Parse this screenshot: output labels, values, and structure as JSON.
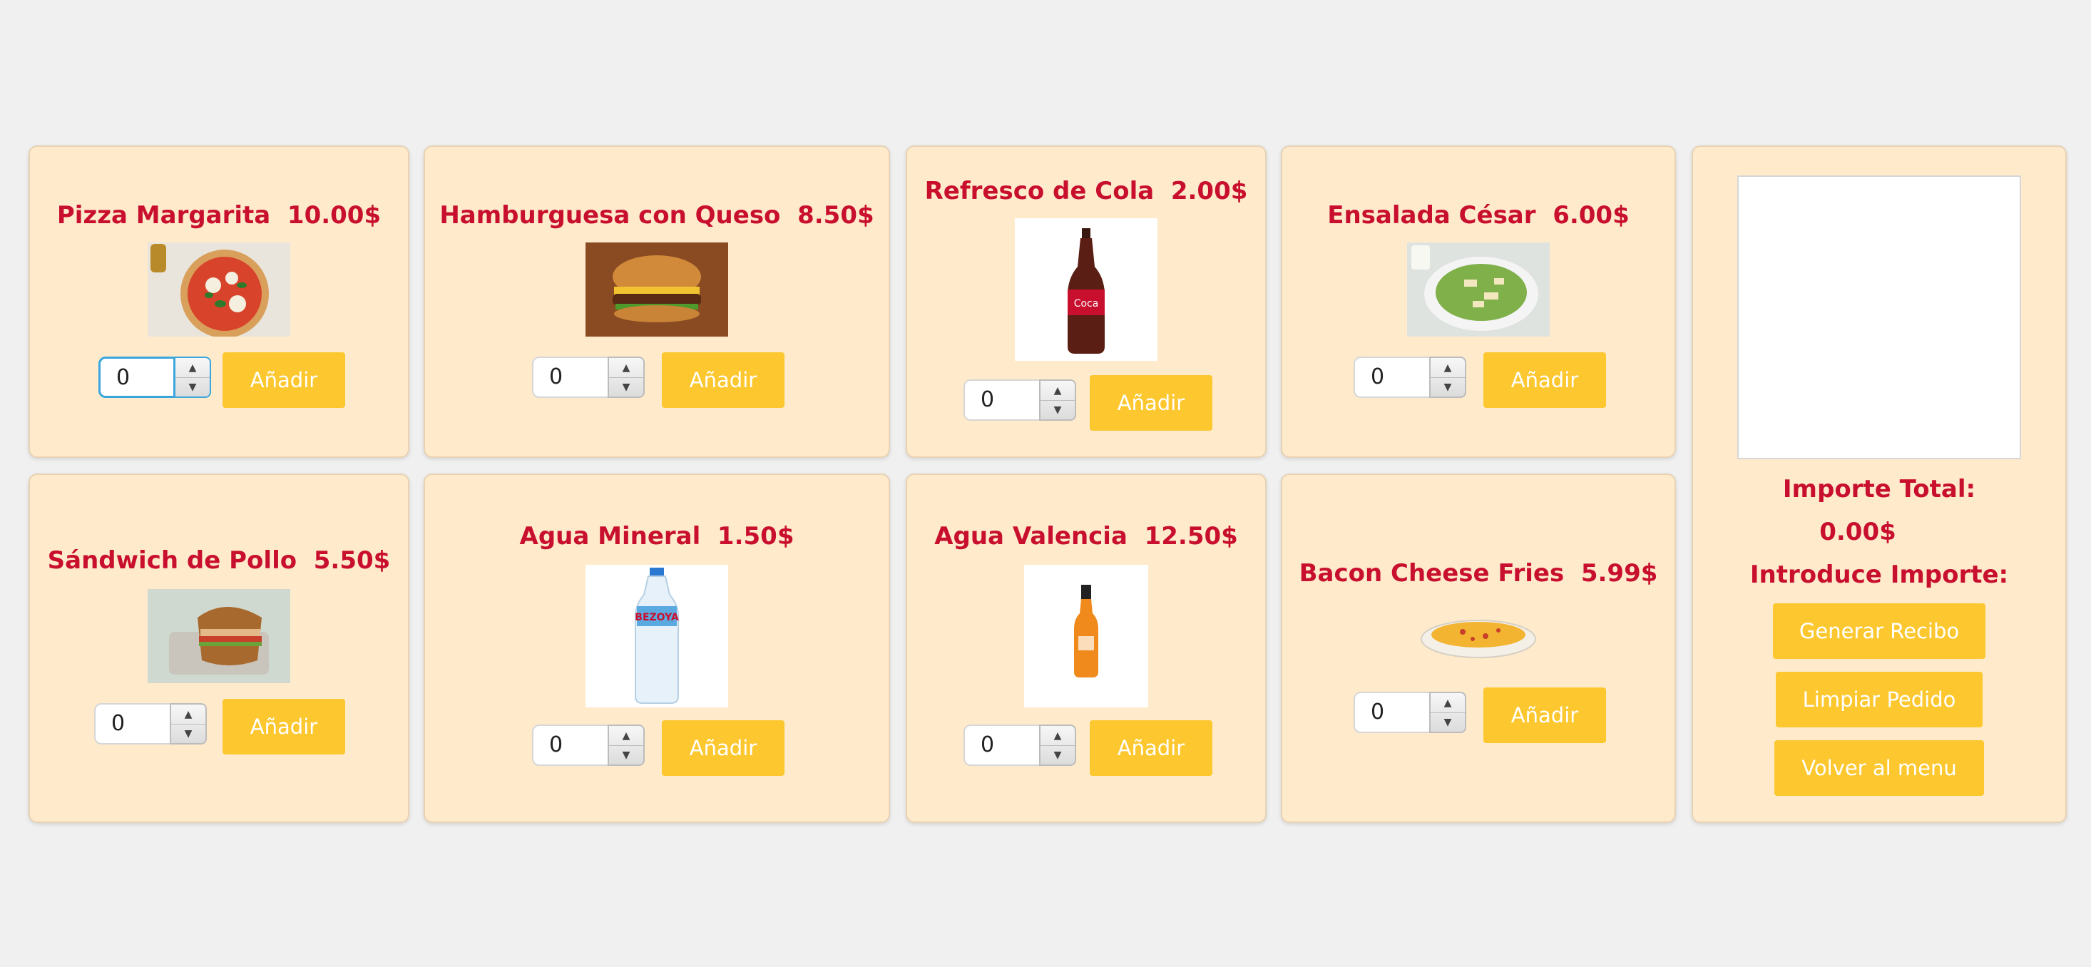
{
  "products": [
    {
      "name": "Pizza Margarita  10.00$",
      "image": "pizza-icon",
      "qty": "0"
    },
    {
      "name": "Hamburguesa con Queso  8.50$",
      "image": "burger-icon",
      "qty": "0"
    },
    {
      "name": "Refresco de Cola  2.00$",
      "image": "cola-bottle-icon",
      "qty": "0"
    },
    {
      "name": "Ensalada César  6.00$",
      "image": "salad-icon",
      "qty": "0"
    },
    {
      "name": "Sándwich de Pollo  5.50$",
      "image": "sandwich-icon",
      "qty": "0"
    },
    {
      "name": "Agua Mineral  1.50$",
      "image": "water-bottle-icon",
      "qty": "0"
    },
    {
      "name": "Agua Valencia  12.50$",
      "image": "orange-bottle-icon",
      "qty": "0"
    },
    {
      "name": "Bacon Cheese Fries  5.99$",
      "image": "fries-plate-icon",
      "qty": "0"
    }
  ],
  "add_label": "Añadir",
  "summary": {
    "total_label": "Importe Total:",
    "total_value": "0.00$",
    "amount_label": "Introduce Importe:",
    "buttons": {
      "generate": "Generar Recibo",
      "clear": "Limpiar Pedido",
      "back": "Volver al menu"
    }
  },
  "colors": {
    "card_bg": "#ffebcc",
    "title": "#c8102e",
    "button": "#fdc72f",
    "focus": "#3aa6dc"
  }
}
